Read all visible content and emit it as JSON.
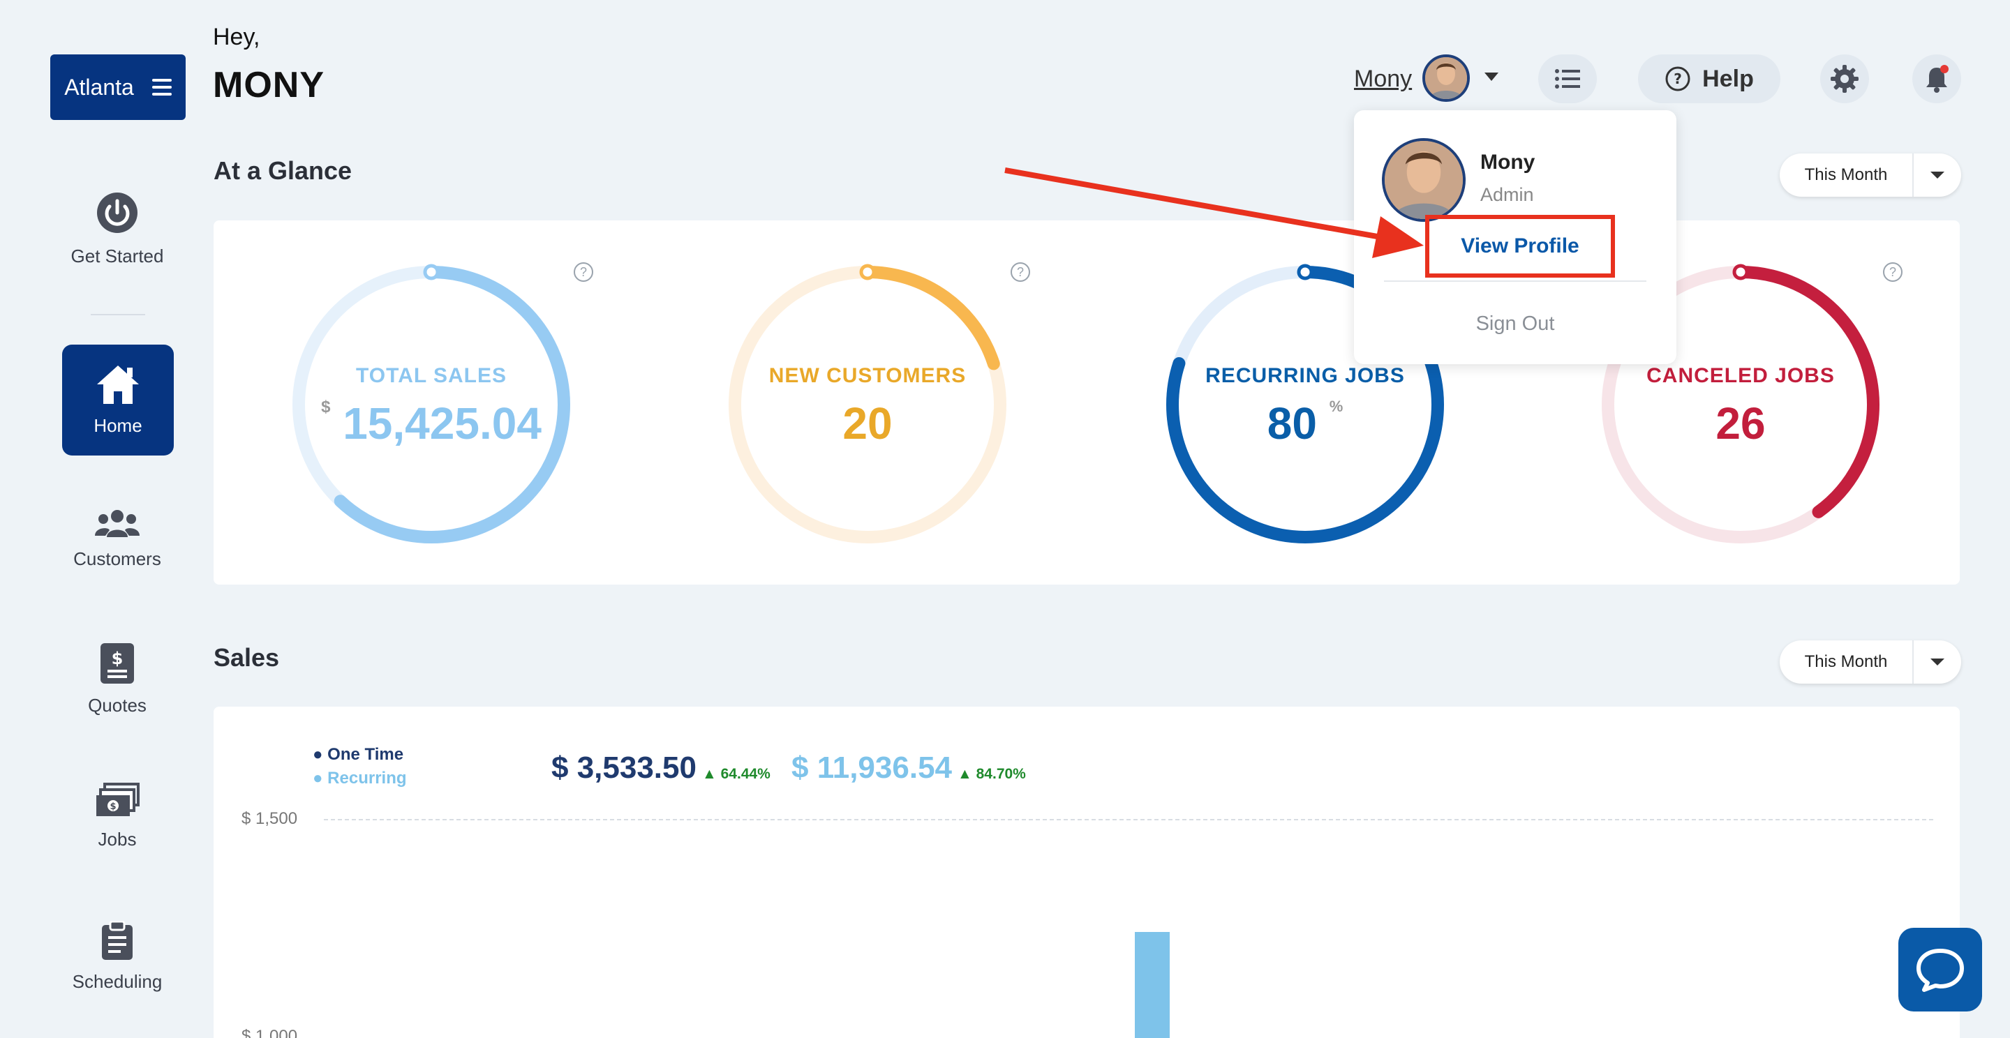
{
  "brand": {
    "label": "Atlanta"
  },
  "header": {
    "greeting": "Hey,",
    "username": "MONY",
    "user_link": "Mony",
    "help_label": "Help"
  },
  "sidebar": {
    "items": [
      {
        "label": "Get Started",
        "icon": "power-icon"
      },
      {
        "label": "Home",
        "icon": "home-icon",
        "active": true
      },
      {
        "label": "Customers",
        "icon": "users-icon"
      },
      {
        "label": "Quotes",
        "icon": "dollar-doc-icon"
      },
      {
        "label": "Jobs",
        "icon": "cash-stack-icon"
      },
      {
        "label": "Scheduling",
        "icon": "clipboard-icon"
      }
    ]
  },
  "glance": {
    "title": "At a Glance",
    "period": "This Month",
    "gauges": [
      {
        "label": "TOTAL SALES",
        "prefix": "$",
        "value": "15,425.04",
        "suffix": "",
        "color": "#97cbf3",
        "track": "#e6f1fb",
        "text_color": "#8cc6f0",
        "progress": 0.62
      },
      {
        "label": "NEW CUSTOMERS",
        "prefix": "",
        "value": "20",
        "suffix": "",
        "color": "#f8b74f",
        "track": "#fdf0df",
        "text_color": "#e9a829",
        "progress": 0.2
      },
      {
        "label": "RECURRING JOBS",
        "prefix": "",
        "value": "80",
        "suffix": "%",
        "color": "#0b5fb0",
        "track": "#e3eefa",
        "text_color": "#0a5ea8",
        "progress": 0.8
      },
      {
        "label": "CANCELED JOBS",
        "prefix": "",
        "value": "26",
        "suffix": "",
        "color": "#c41f3e",
        "track": "#f7e4e8",
        "text_color": "#c21e3c",
        "progress": 0.4
      }
    ]
  },
  "sales": {
    "title": "Sales",
    "period": "This Month",
    "legend": [
      {
        "label": "One Time",
        "color": "#1f3a6e"
      },
      {
        "label": "Recurring",
        "color": "#7ec3ea"
      }
    ],
    "one_time_total": "$ 3,533.50",
    "one_time_delta": "64.44%",
    "recurring_total": "$ 11,936.54",
    "recurring_delta": "84.70%",
    "y_labels": [
      "$ 1,500",
      "$ 1,000"
    ]
  },
  "profile_menu": {
    "name": "Mony",
    "role": "Admin",
    "view_profile": "View Profile",
    "sign_out": "Sign Out"
  },
  "colors": {
    "primary": "#063480",
    "highlight": "#e8311e"
  }
}
